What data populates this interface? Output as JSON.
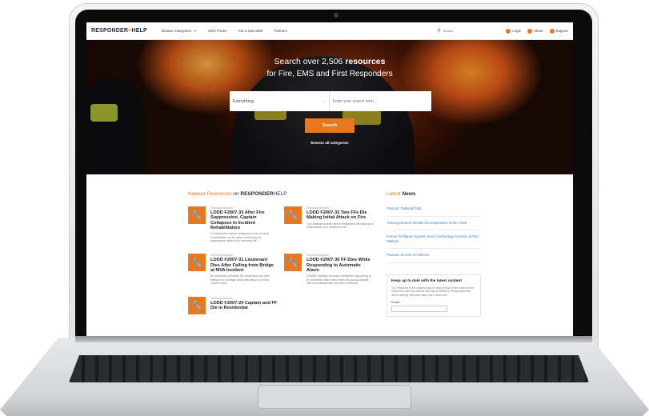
{
  "brand": {
    "name_part1": "RESPONDER",
    "plus": "+",
    "name_part2": "HELP"
  },
  "nav": {
    "items": [
      {
        "label": "Browse Categories",
        "has_dropdown": true
      },
      {
        "label": "SOG Finder"
      },
      {
        "label": "Ask a Specialist"
      },
      {
        "label": "Partners"
      }
    ],
    "search_placeholder": "Search",
    "login": "Login",
    "about": "About",
    "support": "Support"
  },
  "hero": {
    "title_prefix": "Search over 2,506",
    "title_bold": "resources",
    "subtitle": "for Fire, EMS and First Responders",
    "select_value": "Everything",
    "input_placeholder": "Enter your search term...",
    "search_button": "Search",
    "browse_all": "Browse all categories"
  },
  "newest": {
    "title_accent": "Newest Resources",
    "title_mid": "on",
    "title_strong": "RESPONDER",
    "title_light": "HELP",
    "items": [
      {
        "category": "Technical Bulletin",
        "title": "LODD F2007-33 After Fire Suppression, Captain Collapses in Incident Rehabilitation",
        "desc": "A Kansas fire captain collapses in the incident rehabilitation sector after conducting fire suppression duties at a structure fire"
      },
      {
        "category": "Technical Bulletin",
        "title": "LODD F2007-32 Two FFs Die Making Initial Attack on Fire",
        "desc": "Two Massachusetts career firefighters die making an initial attack on a restaurant fire"
      },
      {
        "category": "Technical Bulletin",
        "title": "LODD F2007-31 Lieutenant Dies After Falling from Bridge at MVA Incident",
        "desc": "An Arkansas volunteer fire lieutenant dies after falling from a bridge while attending to a motor vehicle crash"
      },
      {
        "category": "Technical Bulletin",
        "title": "LODD F2007-30 FF Dies While Responding to Automatic Alarm",
        "desc": "A North Carolina volunteer firefighter responding to an automatic alarm dies when his pickup collides with an embankment and then overturns"
      },
      {
        "category": "Technical Bulletin",
        "title": "LODD F2007-29 Captain and FF Die in Residential",
        "desc": ""
      }
    ]
  },
  "news": {
    "title_light": "Latest",
    "title_strong": "News",
    "items": [
      "Podcast: Tailboard Talk",
      "Training Minutes: Needle Decompression of the Chest",
      "Former Firefighter Speaks About Confronting Arsonists at NIO Walmart",
      "Podcast: Scenes of Violence"
    ],
    "subscribe": {
      "title": "Keep up to date with the latest content",
      "desc": "Our email list is the easiest way to stay on top of the most recent resources and documents that we've added to ResponderHelp. We're adding new stuff daily, don't miss out!",
      "email_label": "Email*"
    }
  },
  "colors": {
    "accent": "#e87722",
    "link": "#3a7fc0",
    "brand": "#1b2a3a"
  }
}
